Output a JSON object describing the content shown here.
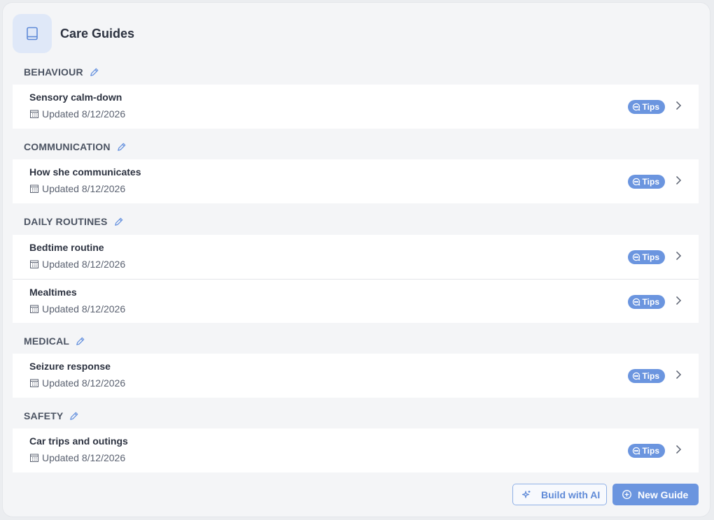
{
  "header": {
    "title": "Care Guides",
    "icon": "book-icon"
  },
  "sections": [
    {
      "label": "BEHAVIOUR",
      "guides": [
        {
          "title": "Sensory calm-down",
          "updated": "Updated 8/12/2026",
          "badge": "Tips"
        }
      ]
    },
    {
      "label": "COMMUNICATION",
      "guides": [
        {
          "title": "How she communicates",
          "updated": "Updated 8/12/2026",
          "badge": "Tips"
        }
      ]
    },
    {
      "label": "DAILY ROUTINES",
      "guides": [
        {
          "title": "Bedtime routine",
          "updated": "Updated 8/12/2026",
          "badge": "Tips"
        },
        {
          "title": "Mealtimes",
          "updated": "Updated 8/12/2026",
          "badge": "Tips"
        }
      ]
    },
    {
      "label": "MEDICAL",
      "guides": [
        {
          "title": "Seizure response",
          "updated": "Updated 8/12/2026",
          "badge": "Tips"
        }
      ]
    },
    {
      "label": "SAFETY",
      "guides": [
        {
          "title": "Car trips and outings",
          "updated": "Updated 8/12/2026",
          "badge": "Tips"
        }
      ]
    }
  ],
  "footer": {
    "build_ai_label": "Build with AI",
    "new_guide_label": "New Guide"
  },
  "colors": {
    "accent": "#6b95df",
    "panel": "#f4f5f7",
    "text": "#2c3240"
  }
}
